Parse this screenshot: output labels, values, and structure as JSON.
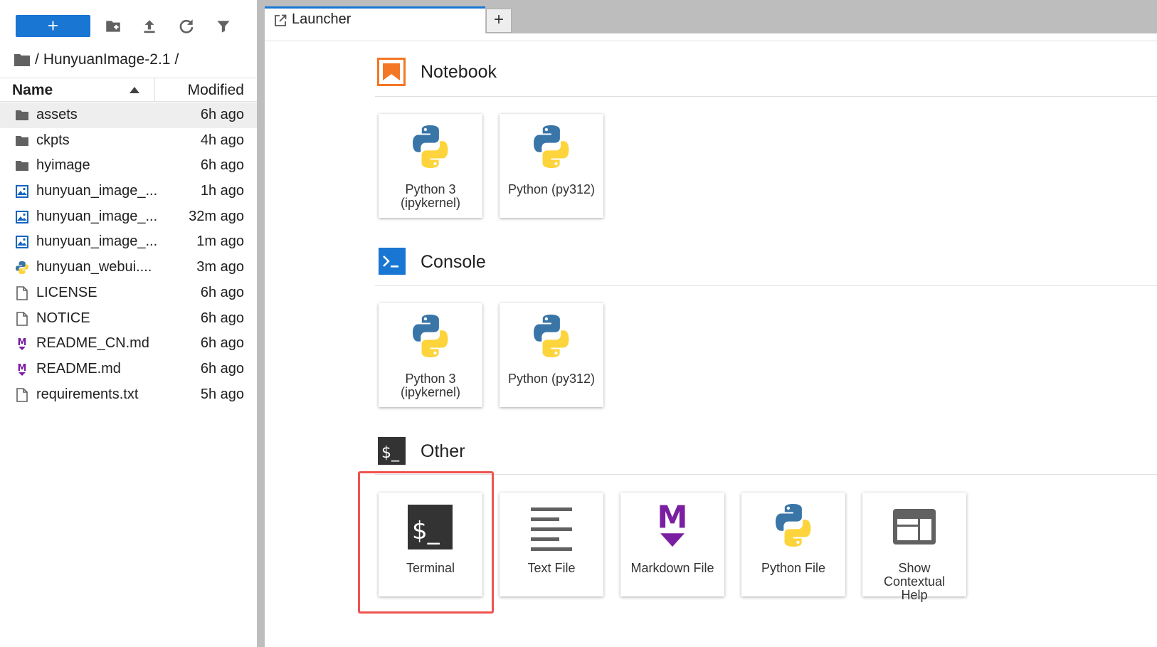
{
  "toolbar": {
    "new_label": "+",
    "icons": [
      "new-folder-icon",
      "upload-icon",
      "refresh-icon",
      "filter-icon"
    ]
  },
  "breadcrumb": {
    "root": "/",
    "folder": "HunyuanImage-2.1",
    "sep": "/"
  },
  "file_list": {
    "headers": {
      "name": "Name",
      "modified": "Modified"
    },
    "files": [
      {
        "name": "assets",
        "modified": "6h ago",
        "icon": "folder-icon"
      },
      {
        "name": "ckpts",
        "modified": "4h ago",
        "icon": "folder-icon"
      },
      {
        "name": "hyimage",
        "modified": "6h ago",
        "icon": "folder-icon"
      },
      {
        "name": "hunyuan_image_...",
        "modified": "1h ago",
        "icon": "image-file-icon"
      },
      {
        "name": "hunyuan_image_...",
        "modified": "32m ago",
        "icon": "image-file-icon"
      },
      {
        "name": "hunyuan_image_...",
        "modified": "1m ago",
        "icon": "image-file-icon"
      },
      {
        "name": "hunyuan_webui....",
        "modified": "3m ago",
        "icon": "python-file-icon"
      },
      {
        "name": "LICENSE",
        "modified": "6h ago",
        "icon": "file-icon"
      },
      {
        "name": "NOTICE",
        "modified": "6h ago",
        "icon": "file-icon"
      },
      {
        "name": "README_CN.md",
        "modified": "6h ago",
        "icon": "markdown-file-icon"
      },
      {
        "name": "README.md",
        "modified": "6h ago",
        "icon": "markdown-file-icon"
      },
      {
        "name": "requirements.txt",
        "modified": "5h ago",
        "icon": "file-icon"
      }
    ]
  },
  "tabs": {
    "launcher_label": "Launcher",
    "add_label": "+"
  },
  "launcher": {
    "notebook": {
      "title": "Notebook",
      "cards": [
        {
          "line1": "Python 3",
          "line2": "(ipykernel)"
        },
        {
          "line1": "Python (py312)",
          "line2": ""
        }
      ]
    },
    "console": {
      "title": "Console",
      "cards": [
        {
          "line1": "Python 3",
          "line2": "(ipykernel)"
        },
        {
          "line1": "Python (py312)",
          "line2": ""
        }
      ]
    },
    "other": {
      "title": "Other",
      "cards": [
        {
          "line1": "Terminal",
          "line2": "",
          "line3": ""
        },
        {
          "line1": "Text File",
          "line2": "",
          "line3": ""
        },
        {
          "line1": "Markdown File",
          "line2": "",
          "line3": ""
        },
        {
          "line1": "Python File",
          "line2": "",
          "line3": ""
        },
        {
          "line1": "Show",
          "line2": "Contextual",
          "line3": "Help"
        }
      ]
    }
  },
  "colors": {
    "accent": "#1976d2",
    "notebook_orange": "#f37726",
    "markdown_purple": "#7b1fa2",
    "highlight_red": "#ef5350",
    "python_blue": "#3a75a8",
    "python_yellow": "#fdd43b"
  }
}
